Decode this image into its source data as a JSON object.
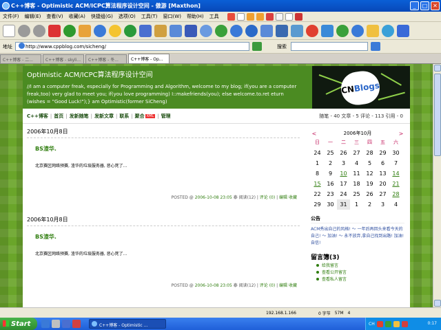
{
  "window": {
    "title": "C++博客 - Optimistic ACM/ICPC算法程序设计空间 - 傲游 [Maxthon]",
    "controls": [
      "_",
      "□",
      "✕"
    ]
  },
  "menubar": {
    "items": [
      "文件(F)",
      "编辑(E)",
      "查看(V)",
      "收藏(A)",
      "快捷组(G)",
      "选项(O)",
      "工具(T)",
      "窗口(W)",
      "帮助(H)"
    ],
    "tools_label": "工具"
  },
  "address": {
    "label": "地址",
    "url": "http://www.cppblog.com/sicheng/",
    "search_label": "搜索",
    "search_value": ""
  },
  "tabs": [
    {
      "label": "C++博客 - 二...",
      "active": false
    },
    {
      "label": "C++博客 - skyli...",
      "active": false
    },
    {
      "label": "C++博客 - 冬...",
      "active": false
    },
    {
      "label": "C++博客 - Op...",
      "active": true
    }
  ],
  "site": {
    "title": "Optimistic ACM/ICPC算法程序设计空间",
    "description": "//I am a computer freak, especially for Programming and Algorithm, welcome to my blog; if(you are a computer freak,too) very glad to meet you; if(you love programming) I::makefriends(you); else welcome.to.ret eturn (wishes = \"Good Luck!\");} am Optimistic(former SiCheng)",
    "logo_text_1": "CN",
    "logo_text_2": "Blogs",
    "nav": [
      "C++博客",
      "首页",
      "发新随笔",
      "发新文章",
      "联系",
      "聚合",
      "管理"
    ],
    "new_badge": "XML",
    "stats": "随笔 - 40  文章 - 5  评论 - 113  引用 - 0"
  },
  "posts": [
    {
      "date": "2006年10月8日",
      "title": "BS渣华.",
      "body": "北京赛区网络预赛, 渣华的垃圾服务器, 恶心死了...",
      "footer_prefix": "POSTED @ ",
      "footer_time": "2006-10-08 23:05",
      "footer_author": " 泰 ",
      "footer_read": "阅读(12)",
      "footer_comment": "评论 (0)",
      "footer_edit": "编辑",
      "footer_fav": "收藏"
    },
    {
      "date": "2006年10月8日",
      "title": "BS渣华.",
      "body": "北京赛区网络预赛, 渣华的垃圾服务器, 恶心死了...",
      "footer_prefix": "POSTED @ ",
      "footer_time": "2006-10-08 23:05",
      "footer_author": " 泰 ",
      "footer_read": "阅读(12)",
      "footer_comment": "评论 (0)",
      "footer_edit": "编辑",
      "footer_fav": "收藏"
    }
  ],
  "calendar": {
    "month_label": "2006年10月",
    "prev": "<",
    "next": ">",
    "weekdays": [
      "日",
      "一",
      "二",
      "三",
      "四",
      "五",
      "六"
    ],
    "days": [
      {
        "t": "24",
        "link": false
      },
      {
        "t": "25",
        "link": false
      },
      {
        "t": "26",
        "link": false
      },
      {
        "t": "27",
        "link": false
      },
      {
        "t": "28",
        "link": false
      },
      {
        "t": "29",
        "link": false
      },
      {
        "t": "30",
        "link": false
      },
      {
        "t": "1",
        "link": false
      },
      {
        "t": "2",
        "link": false
      },
      {
        "t": "3",
        "link": false
      },
      {
        "t": "4",
        "link": false
      },
      {
        "t": "5",
        "link": false
      },
      {
        "t": "6",
        "link": false
      },
      {
        "t": "7",
        "link": false
      },
      {
        "t": "8",
        "link": false
      },
      {
        "t": "9",
        "link": false
      },
      {
        "t": "10",
        "link": true
      },
      {
        "t": "11",
        "link": false
      },
      {
        "t": "12",
        "link": false
      },
      {
        "t": "13",
        "link": false
      },
      {
        "t": "14",
        "link": true
      },
      {
        "t": "15",
        "link": true
      },
      {
        "t": "16",
        "link": false
      },
      {
        "t": "17",
        "link": false
      },
      {
        "t": "18",
        "link": false
      },
      {
        "t": "19",
        "link": false
      },
      {
        "t": "20",
        "link": false
      },
      {
        "t": "21",
        "link": true
      },
      {
        "t": "22",
        "link": false
      },
      {
        "t": "23",
        "link": false
      },
      {
        "t": "24",
        "link": false
      },
      {
        "t": "25",
        "link": false
      },
      {
        "t": "26",
        "link": false
      },
      {
        "t": "27",
        "link": false
      },
      {
        "t": "28",
        "link": true
      },
      {
        "t": "29",
        "link": false
      },
      {
        "t": "30",
        "link": false
      },
      {
        "t": "31",
        "link": false,
        "today": true
      },
      {
        "t": "1",
        "link": false
      },
      {
        "t": "2",
        "link": false
      },
      {
        "t": "3",
        "link": false
      },
      {
        "t": "4",
        "link": false
      }
    ]
  },
  "sidebar": {
    "notice_heading": "公告",
    "notice": "ACM秀出自己的风格! ～ 一年后再回头来看今天的自己! ～ 加油! ～ 永不放弃,拿自己找到出路! 加油! 自信!",
    "guestbook_heading": "留言簿(3)",
    "guestbook_items": [
      "给我留言",
      "查看公开留言",
      "查看私人留言"
    ]
  },
  "statusbar": {
    "ip": "192.168.1.166",
    "bytes": "0 字节",
    "mem": "57M",
    "count": "4"
  },
  "taskbar": {
    "start": "Start",
    "task_label": "C++博客 - Optimistic ...",
    "lang": "CH",
    "time": "0:17"
  }
}
